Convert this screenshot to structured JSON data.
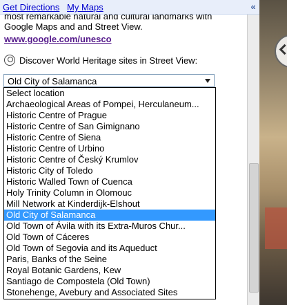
{
  "topbar": {
    "get_directions": "Get Directions",
    "my_maps": "My Maps",
    "collapse_glyph": "«"
  },
  "panel": {
    "intro_text": "most remarkable natural and cultural landmarks with Google Maps and and Street View.",
    "unesco_link": "www.google.com/unesco",
    "streetview_label": "Discover World Heritage sites in Street View:",
    "select_value": "Old City of Salamanca",
    "options": [
      "Select location",
      "Archaeological Areas of Pompei, Herculaneum...",
      "Historic Centre of Prague",
      "Historic Centre of San Gimignano",
      "Historic Centre of Siena",
      "Historic Centre of Urbino",
      "Historic Centre of Český Krumlov",
      "Historic City of Toledo",
      "Historic Walled Town of Cuenca",
      "Holy Trinity Column in Olomouc",
      "Mill Network at Kinderdijk-Elshout",
      "Old City of Salamanca",
      "Old Town of Ávila with its Extra-Muros Chur...",
      "Old Town of Cáceres",
      "Old Town of Segovia and its Aqueduct",
      "Paris, Banks of the Seine",
      "Royal Botanic Gardens, Kew",
      "Santiago de Compostela (Old Town)",
      "Stonehenge, Avebury and Associated Sites"
    ],
    "selected_index": 11
  },
  "icons": {
    "streetview": "streetview-icon",
    "dropdown_arrow": "chevron-down-icon",
    "map_nav": "pan-control-icon"
  },
  "colors": {
    "link": "#0000cc",
    "visited_link": "#551a8b",
    "selection": "#3399ff",
    "topbar_bg": "#e8eefa"
  }
}
